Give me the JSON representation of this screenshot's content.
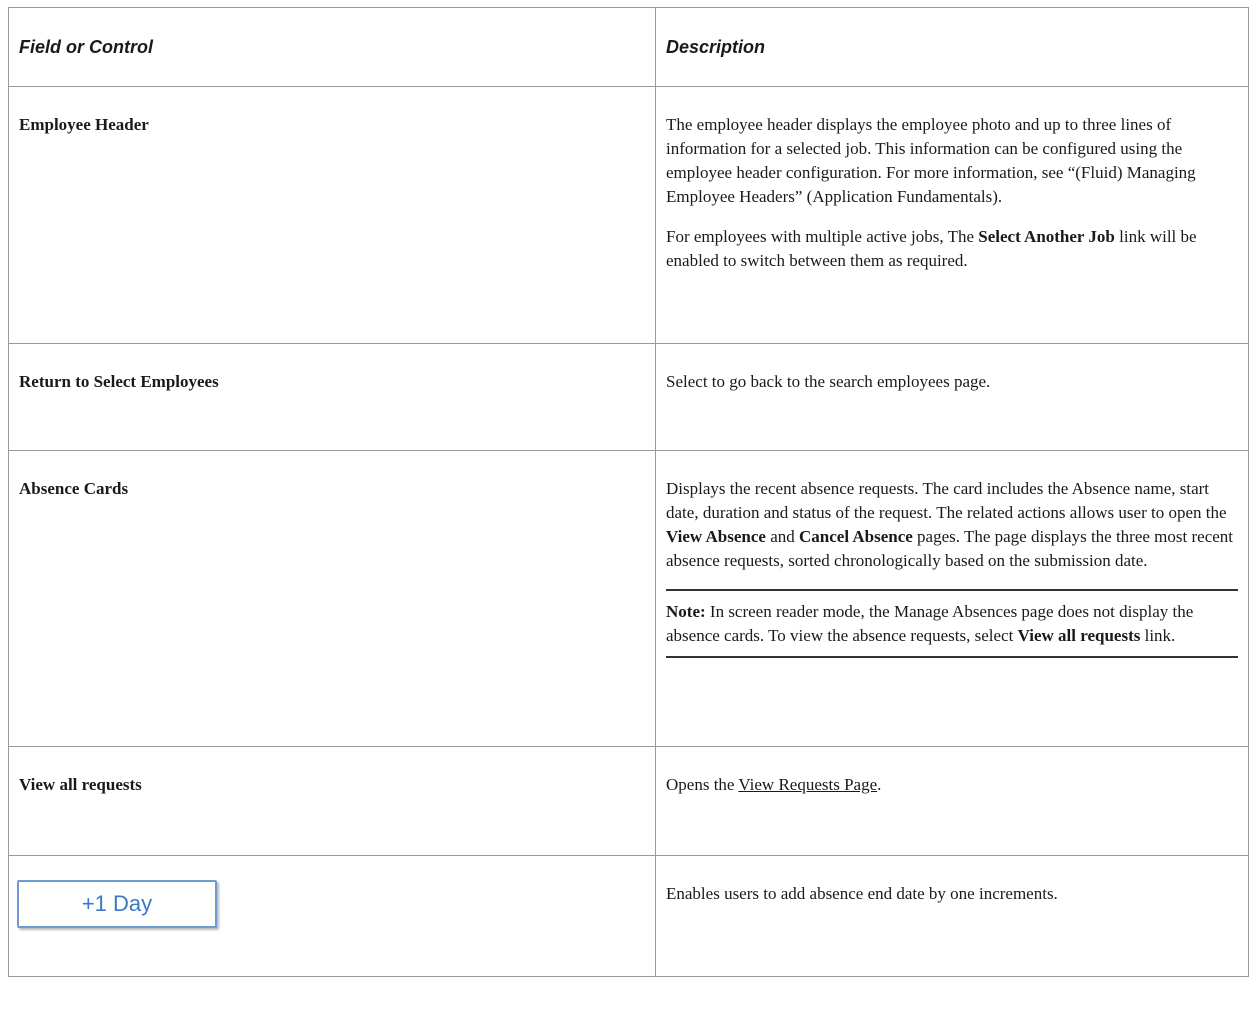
{
  "table": {
    "header": {
      "field": "Field or Control",
      "description": "Description"
    },
    "rows": {
      "employee_header": {
        "field": "Employee Header",
        "desc_p1": "The employee header displays the employee photo and up to three lines of information for a selected job. This information can be configured using the employee header configuration.  For more information, see “(Fluid) Managing Employee Headers” (Application Fundamentals).",
        "desc_p2_a": "For employees with multiple active jobs, The ",
        "desc_p2_bold": "Select Another Job",
        "desc_p2_b": " link will be enabled to switch between them as required."
      },
      "return_select": {
        "field": "Return to Select Employees",
        "desc": "Select to go back to the search employees page."
      },
      "absence_cards": {
        "field": "Absence Cards",
        "desc_a": "Displays the recent absence requests. The card includes the Absence name, start date, duration and status of the request.  The related actions allows user to open the ",
        "desc_bold1": "View Absence",
        "desc_b": " and ",
        "desc_bold2": "Cancel Absence",
        "desc_c": " pages. The page displays the three most recent absence requests, sorted chronologically based on the submission date.",
        "note_label": "Note:",
        "note_a": " In screen reader mode, the Manage Absences page does not display the absence cards. To view the absence requests,  select ",
        "note_bold": "View all requests",
        "note_b": " link."
      },
      "view_all": {
        "field": "View all requests",
        "desc_a": "Opens the ",
        "desc_link": "View Requests Page",
        "desc_b": "."
      },
      "plus_one_day": {
        "button_label": "+1 Day",
        "desc": "Enables users to add absence end date by one increments."
      }
    }
  },
  "colors": {
    "border": "#9a9a9a",
    "button_border": "#6f9bd4",
    "button_text": "#3a79c8"
  }
}
